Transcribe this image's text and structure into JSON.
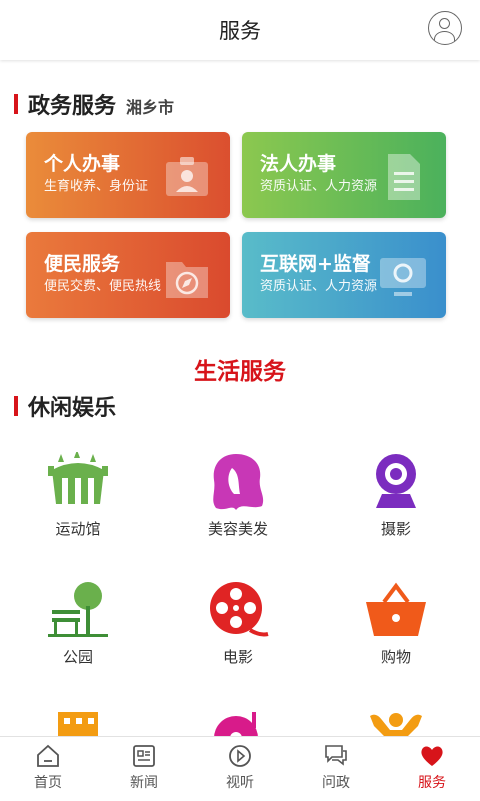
{
  "header": {
    "title": "服务"
  },
  "gov": {
    "title": "政务服务",
    "city": "湘乡市",
    "cards": [
      {
        "title": "个人办事",
        "sub": "生育收养、身份证"
      },
      {
        "title": "法人办事",
        "sub": "资质认证、人力资源"
      },
      {
        "title": "便民服务",
        "sub": "便民交费、便民热线"
      },
      {
        "title": "互联网+监督",
        "sub": "资质认证、人力资源"
      }
    ]
  },
  "life": {
    "title": "生活服务"
  },
  "leisure": {
    "title": "休闲娱乐",
    "items": [
      {
        "label": "运动馆",
        "icon": "stadium-icon"
      },
      {
        "label": "美容美发",
        "icon": "beauty-icon"
      },
      {
        "label": "摄影",
        "icon": "webcam-icon"
      },
      {
        "label": "公园",
        "icon": "park-icon"
      },
      {
        "label": "电影",
        "icon": "film-reel-icon"
      },
      {
        "label": "购物",
        "icon": "basket-icon"
      }
    ]
  },
  "tabs": [
    {
      "label": "首页",
      "icon": "home-icon"
    },
    {
      "label": "新闻",
      "icon": "news-icon"
    },
    {
      "label": "视听",
      "icon": "play-icon"
    },
    {
      "label": "问政",
      "icon": "chat-icon"
    },
    {
      "label": "服务",
      "icon": "heart-icon",
      "active": true
    }
  ],
  "colors": {
    "accent": "#d7141a"
  }
}
